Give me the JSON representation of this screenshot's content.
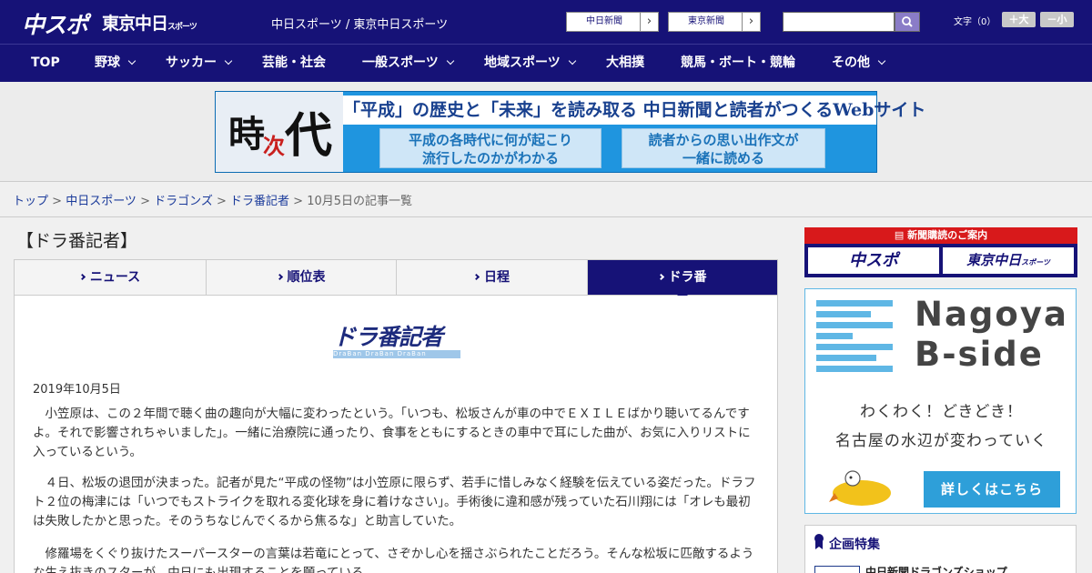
{
  "header": {
    "logo_chunichi_sports": "中スポ",
    "logo_tokyo_chunichi": "東京中日",
    "logo_tokyo_chunichi_small": "スポーツ",
    "site_title": "中日スポーツ / 東京中日スポーツ",
    "btn_chunichi_shimbun": "中日新聞",
    "btn_tokyo_shimbun": "東京新聞",
    "search_placeholder": "",
    "font_size_label": "文字（0）",
    "font_bigger": "＋大",
    "font_smaller": "－小"
  },
  "nav": {
    "items": [
      {
        "label": "TOP"
      },
      {
        "label": "野球"
      },
      {
        "label": "サッカー"
      },
      {
        "label": "芸能・社会"
      },
      {
        "label": "一般スポーツ"
      },
      {
        "label": "地域スポーツ"
      },
      {
        "label": "大相撲"
      },
      {
        "label": "競馬・ボート・競輪"
      },
      {
        "label": "その他"
      }
    ]
  },
  "banner": {
    "ji": "時",
    "tsugi": "次",
    "dai": "代",
    "headline": "「平成」の歴史と「未来」を読み取る 中日新聞と読者がつくるWebサイト",
    "box1_line1": "平成の各時代に何が起こり",
    "box1_line2": "流行したのかがわかる",
    "box2_line1": "読者からの思い出作文が",
    "box2_line2": "一緒に読める"
  },
  "breadcrumb": {
    "top": "トップ",
    "chunichi_sports": "中日スポーツ",
    "dragons": "ドラゴンズ",
    "draban": "ドラ番記者",
    "current": "10月5日の記事一覧",
    "sep": " > "
  },
  "main": {
    "page_title": "【ドラ番記者】",
    "tabs": [
      {
        "label": "ニュース"
      },
      {
        "label": "順位表"
      },
      {
        "label": "日程"
      },
      {
        "label": "ドラ番"
      }
    ],
    "logo_text": "ドラ番記者",
    "logo_sub": "DraBan DraBan DraBan",
    "date": "2019年10月5日",
    "paragraphs": [
      "　小笠原は、この２年間で聴く曲の趣向が大幅に変わったという。「いつも、松坂さんが車の中でＥＸＩＬＥばかり聴いてるんですよ。それで影響されちゃいました」。一緒に治療院に通ったり、食事をともにするときの車中で耳にした曲が、お気に入りリストに入っているという。",
      "　４日、松坂の退団が決まった。記者が見た“平成の怪物”は小笠原に限らず、若手に惜しみなく経験を伝えている姿だった。ドラフト２位の梅津には「いつでもストライクを取れる変化球を身に着けなさい」。手術後に違和感が残っていた石川翔には「オレも最初は失敗したかと思った。そのうちなじんでくるから焦るな」と助言していた。",
      "　修羅場をくぐり抜けたスーパースターの言葉は若竜にとって、さぞかし心を揺さぶられたことだろう。そんな松坂に匹敵するような生え抜きのスターが、中日にも出現することを願っている。"
    ]
  },
  "sidebar": {
    "subscribe_head": "新聞購読のご案内",
    "subscribe_chuspo": "中スポ",
    "subscribe_tokyo": "東京中日",
    "subscribe_tokyo_small": "スポーツ",
    "ad_title1": "Nagoya",
    "ad_title2": "B-side",
    "ad_line1": "わくわく！どきどき！",
    "ad_line2": "名古屋の水辺が変わっていく",
    "ad_button": "詳しくはこちら",
    "feature_title": "企画特集",
    "feature_item": "中日新聞ドラゴンズショップ"
  }
}
